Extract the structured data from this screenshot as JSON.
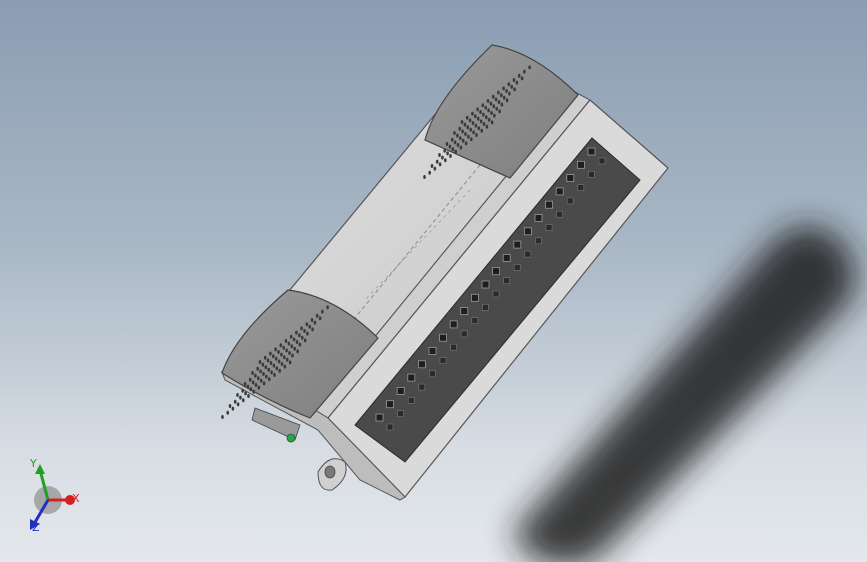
{
  "viewport": {
    "background_top": "#8a9db2",
    "background_bottom": "#e4e8ec"
  },
  "part": {
    "body_color": "#d4d4d4",
    "grip_color": "#8c8c8c",
    "terminal_strip_color": "#4a4a4a",
    "terminal_count": 21
  },
  "triad": {
    "x_label": "X",
    "y_label": "Y",
    "z_label": "Z",
    "x_color": "#d42020",
    "y_color": "#20a020",
    "z_color": "#2030c0"
  }
}
